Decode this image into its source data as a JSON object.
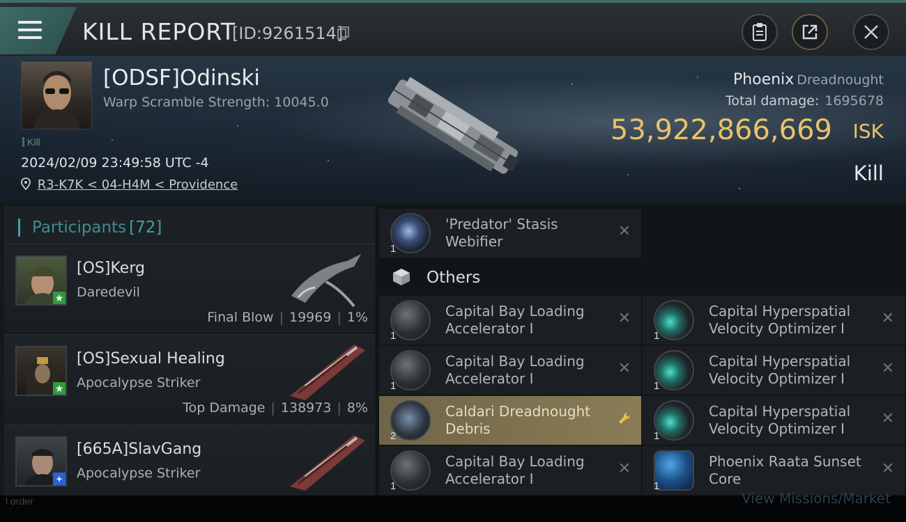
{
  "header": {
    "title": "KILL REPORT",
    "report_id": "[ID:9261514]"
  },
  "victim": {
    "name": "[ODSF]Odinski",
    "warp_scramble": "Warp Scramble Strength: 10045.0",
    "kill_tag": "Kill",
    "datetime": "2024/02/09 23:49:58 UTC -4",
    "location": "R3-K7K < 04-H4M < Providence",
    "ship_name": "Phoenix",
    "ship_class": "Dreadnought",
    "total_damage_label": "Total damage:",
    "total_damage_value": "1695678",
    "isk_value": "53,922,866,669",
    "isk_unit": "ISK",
    "result": "Kill"
  },
  "participants": {
    "title": "Participants",
    "count": "[72]",
    "items": [
      {
        "name": "[OS]Kerg",
        "ship": "Daredevil",
        "stat_label": "Final Blow",
        "damage": "19969",
        "percent": "1%",
        "badge": "★"
      },
      {
        "name": "[OS]Sexual Healing",
        "ship": "Apocalypse Striker",
        "stat_label": "Top Damage",
        "damage": "138973",
        "percent": "8%",
        "badge": "★"
      },
      {
        "name": "[665A]SlavGang",
        "ship": "Apocalypse Striker",
        "badge": "+"
      }
    ]
  },
  "modules": {
    "top": {
      "name": "'Predator' Stasis Webifier",
      "qty": "1"
    },
    "others_title": "Others",
    "left": [
      {
        "name": "Capital Bay Loading Accelerator I",
        "qty": "1"
      },
      {
        "name": "Capital Bay Loading Accelerator I",
        "qty": "1"
      },
      {
        "name": "Caldari Dreadnought Debris",
        "qty": "2"
      },
      {
        "name": "Capital Bay Loading Accelerator I",
        "qty": "1"
      }
    ],
    "right": [
      {
        "name": "Capital Hyperspatial Velocity Optimizer I",
        "qty": "1"
      },
      {
        "name": "Capital Hyperspatial Velocity Optimizer I",
        "qty": "1"
      },
      {
        "name": "Capital Hyperspatial Velocity Optimizer I",
        "qty": "1"
      },
      {
        "name": "Phoenix Raata Sunset Core",
        "qty": "1"
      }
    ]
  },
  "footer": {
    "left_text": "l order",
    "right_text": "View Missions/Market"
  },
  "colors": {
    "accent_teal": "#3fa3a0",
    "isk_gold": "#e8c36a",
    "highlight_gold": "#8a7c56",
    "badge_green": "#2f9b3c",
    "badge_blue": "#2d5fd6"
  },
  "icons": {
    "menu": "menu-icon",
    "copy": "copy-icon",
    "clipboard": "clipboard-icon",
    "share": "share-icon",
    "close": "close-icon",
    "location": "location-pin-icon",
    "others": "cube-icon",
    "destroyed": "x-icon",
    "dropped": "wrench-icon"
  }
}
